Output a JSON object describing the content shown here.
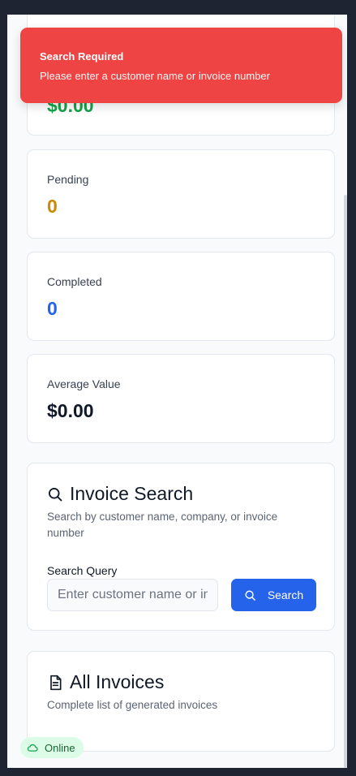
{
  "toast": {
    "title": "Search Required",
    "message": "Please enter a customer name or invoice number"
  },
  "stats": {
    "total_value": {
      "value": "$0.00",
      "color": "#16a34a"
    },
    "pending": {
      "label": "Pending",
      "value": "0",
      "color": "#ca8a04"
    },
    "completed": {
      "label": "Completed",
      "value": "0",
      "color": "#2563eb"
    },
    "average": {
      "label": "Average Value",
      "value": "$0.00",
      "color": "#111827"
    }
  },
  "invoice_search": {
    "icon": "search-icon",
    "title": "Invoice Search",
    "description": "Search by customer name, company, or invoice number",
    "field_label": "Search Query",
    "placeholder": "Enter customer name or invoice number",
    "value": "",
    "button_label": "Search"
  },
  "all_invoices": {
    "icon": "document-icon",
    "title": "All Invoices",
    "description": "Complete list of generated invoices"
  },
  "status": {
    "icon": "cloud-icon",
    "label": "Online",
    "color": "#16a34a"
  }
}
